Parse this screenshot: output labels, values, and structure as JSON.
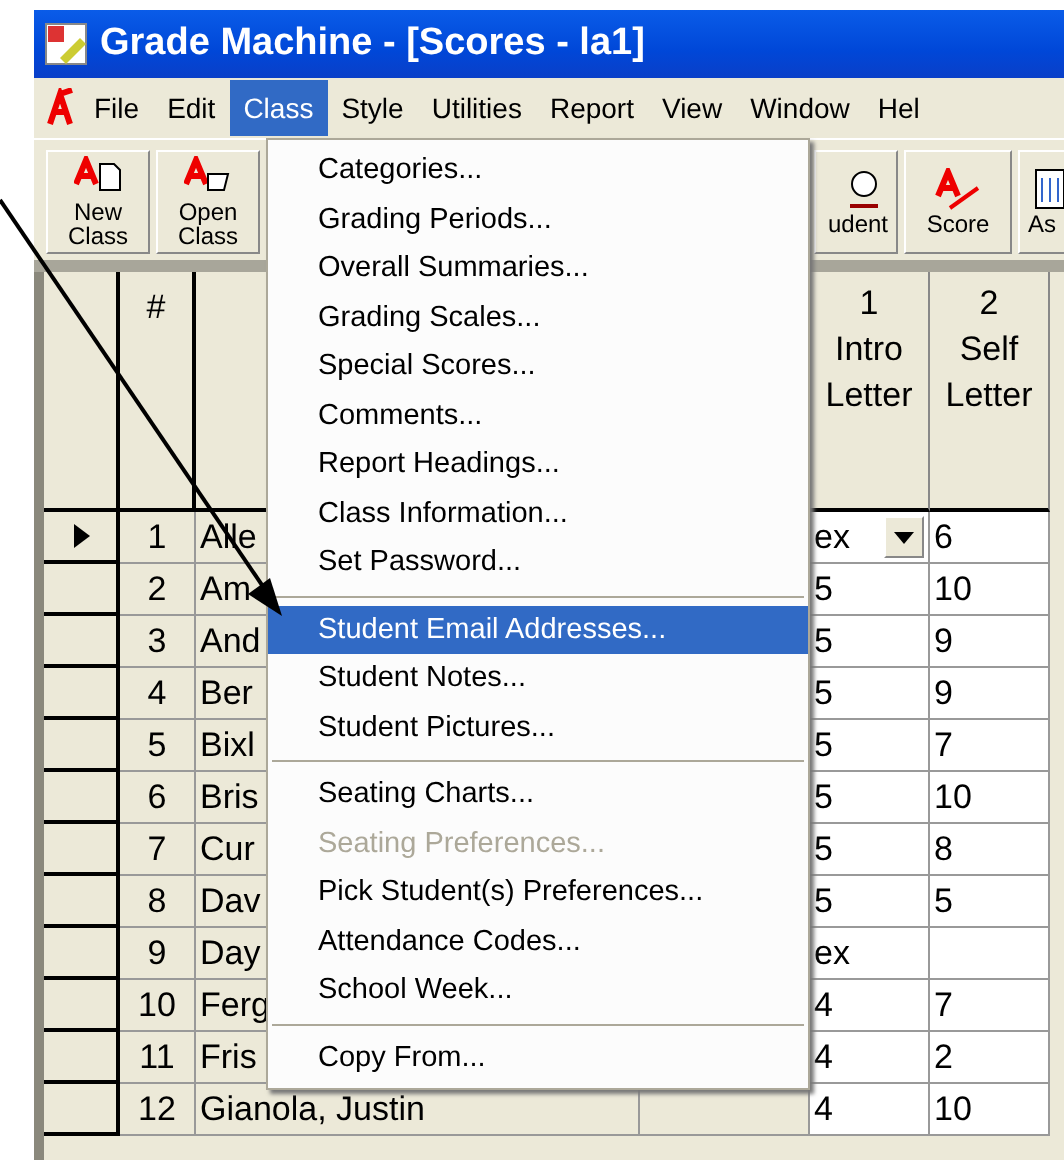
{
  "window": {
    "title": "Grade Machine - [Scores - la1]"
  },
  "menu_bar": [
    {
      "label": "File",
      "selected": false
    },
    {
      "label": "Edit",
      "selected": false
    },
    {
      "label": "Class",
      "selected": true
    },
    {
      "label": "Style",
      "selected": false
    },
    {
      "label": "Utilities",
      "selected": false
    },
    {
      "label": "Report",
      "selected": false
    },
    {
      "label": "View",
      "selected": false
    },
    {
      "label": "Window",
      "selected": false
    },
    {
      "label": "Hel",
      "selected": false
    }
  ],
  "toolbar": [
    {
      "kind": "new",
      "label": "New Class"
    },
    {
      "kind": "open",
      "label": "Open Class"
    },
    {
      "kind": "student",
      "label": "udent"
    },
    {
      "kind": "score",
      "label": "Score"
    },
    {
      "kind": "assign",
      "label": "As"
    }
  ],
  "grid": {
    "columns": [
      {
        "label": "#"
      },
      {
        "number": "1",
        "title": "Intro Letter"
      },
      {
        "number": "2",
        "title": "Self Letter"
      }
    ],
    "rows": [
      {
        "num": "1",
        "name": "Alle",
        "score_1": "ex",
        "score_2": "6",
        "current": true
      },
      {
        "num": "2",
        "name": "Am",
        "score_1": "5",
        "score_2": "10",
        "current": false
      },
      {
        "num": "3",
        "name": "And",
        "score_1": "5",
        "score_2": "9",
        "current": false
      },
      {
        "num": "4",
        "name": "Ber",
        "score_1": "5",
        "score_2": "9",
        "current": false
      },
      {
        "num": "5",
        "name": "Bixl",
        "score_1": "5",
        "score_2": "7",
        "current": false
      },
      {
        "num": "6",
        "name": "Bris",
        "score_1": "5",
        "score_2": "10",
        "current": false
      },
      {
        "num": "7",
        "name": "Cur",
        "score_1": "5",
        "score_2": "8",
        "current": false
      },
      {
        "num": "8",
        "name": "Dav",
        "score_1": "5",
        "score_2": "5",
        "current": false
      },
      {
        "num": "9",
        "name": "Day",
        "score_1": "ex",
        "current": false
      },
      {
        "num": "10",
        "name": "Ferg",
        "score_1": "4",
        "score_2": "7",
        "current": false
      },
      {
        "num": "11",
        "name": "Fris",
        "score_1": "4",
        "score_2": "2",
        "current": false
      },
      {
        "num": "12",
        "name": "Gianola, Justin",
        "score_1": "4",
        "score_2": "10",
        "current": false
      }
    ]
  },
  "class_menu": [
    {
      "kind": "item",
      "label": "Categories...",
      "disabled": false,
      "selected": false
    },
    {
      "kind": "item",
      "label": "Grading Periods...",
      "disabled": false,
      "selected": false
    },
    {
      "kind": "item",
      "label": "Overall Summaries...",
      "disabled": false,
      "selected": false
    },
    {
      "kind": "item",
      "label": "Grading Scales...",
      "disabled": false,
      "selected": false
    },
    {
      "kind": "item",
      "label": "Special Scores...",
      "disabled": false,
      "selected": false
    },
    {
      "kind": "item",
      "label": "Comments...",
      "disabled": false,
      "selected": false
    },
    {
      "kind": "item",
      "label": "Report Headings...",
      "disabled": false,
      "selected": false
    },
    {
      "kind": "item",
      "label": "Class Information...",
      "disabled": false,
      "selected": false
    },
    {
      "kind": "item",
      "label": "Set Password...",
      "disabled": false,
      "selected": false
    },
    {
      "kind": "separator"
    },
    {
      "kind": "item",
      "label": "Student Email Addresses...",
      "disabled": false,
      "selected": true
    },
    {
      "kind": "item",
      "label": "Student Notes...",
      "disabled": false,
      "selected": false
    },
    {
      "kind": "item",
      "label": "Student Pictures...",
      "disabled": false,
      "selected": false
    },
    {
      "kind": "separator"
    },
    {
      "kind": "item",
      "label": "Seating Charts...",
      "disabled": false,
      "selected": false
    },
    {
      "kind": "item",
      "label": "Seating Preferences...",
      "disabled": true,
      "selected": false
    },
    {
      "kind": "item",
      "label": "Pick Student(s) Preferences...",
      "disabled": false,
      "selected": false
    },
    {
      "kind": "item",
      "label": "Attendance Codes...",
      "disabled": false,
      "selected": false
    },
    {
      "kind": "item",
      "label": "School Week...",
      "disabled": false,
      "selected": false
    },
    {
      "kind": "separator"
    },
    {
      "kind": "item",
      "label": "Copy From...",
      "disabled": false,
      "selected": false
    }
  ]
}
